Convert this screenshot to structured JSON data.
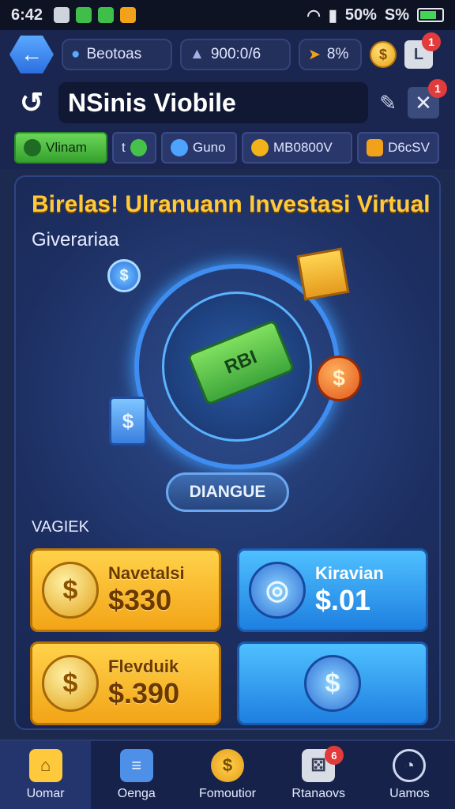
{
  "status_bar": {
    "time": "6:42",
    "battery_text": "50%",
    "signal_text": "S%"
  },
  "top_bar": {
    "back_icon": "arrow-left-icon",
    "user_pill": "Beotoas",
    "stat_pill": "900:0/6",
    "boost_pill": "8%",
    "notification_count": "1"
  },
  "header": {
    "app_title": "NSinis Viobile",
    "close_badge": "1"
  },
  "tabs": [
    {
      "label": "Vlinam",
      "active": true
    },
    {
      "label": "t",
      "active": false
    },
    {
      "label": "Guno",
      "active": false
    },
    {
      "label": "MB0800V",
      "active": false
    },
    {
      "label": "D6cSV",
      "active": false
    }
  ],
  "hero": {
    "title": "Birelas! Ulranuann Investasi Virtual",
    "subtitle": "Giverariaa",
    "money_label": "RBI",
    "cta_label": "DIANGUE"
  },
  "section_label": "VAGIEK",
  "cards": [
    {
      "label": "Navetalsi",
      "value": "$330",
      "style": "gold",
      "icon": "coin-icon",
      "glyph": "$"
    },
    {
      "label": "Kiravian",
      "value": "$.01",
      "style": "blue",
      "icon": "vault-icon",
      "glyph": "◎"
    },
    {
      "label": "Flevduik",
      "value": "$.390",
      "style": "gold",
      "icon": "cash-stack-icon",
      "glyph": "$"
    },
    {
      "label": "",
      "value": "",
      "style": "blue",
      "icon": "wallet-icon",
      "glyph": "$"
    }
  ],
  "bottom_nav": [
    {
      "label": "Uomar",
      "icon": "home-icon",
      "active": true
    },
    {
      "label": "Oenga",
      "icon": "clipboard-icon",
      "active": false
    },
    {
      "label": "Fomoutior",
      "icon": "coin-icon",
      "active": false
    },
    {
      "label": "Rtanaovs",
      "icon": "dice-icon",
      "active": false,
      "badge": "6"
    },
    {
      "label": "Uamos",
      "icon": "search-icon",
      "active": false
    }
  ],
  "colors": {
    "accent_gold": "#ffc93c",
    "accent_blue": "#3f8df0",
    "active_tab_green": "#36a22f",
    "badge_red": "#e23b3b"
  }
}
